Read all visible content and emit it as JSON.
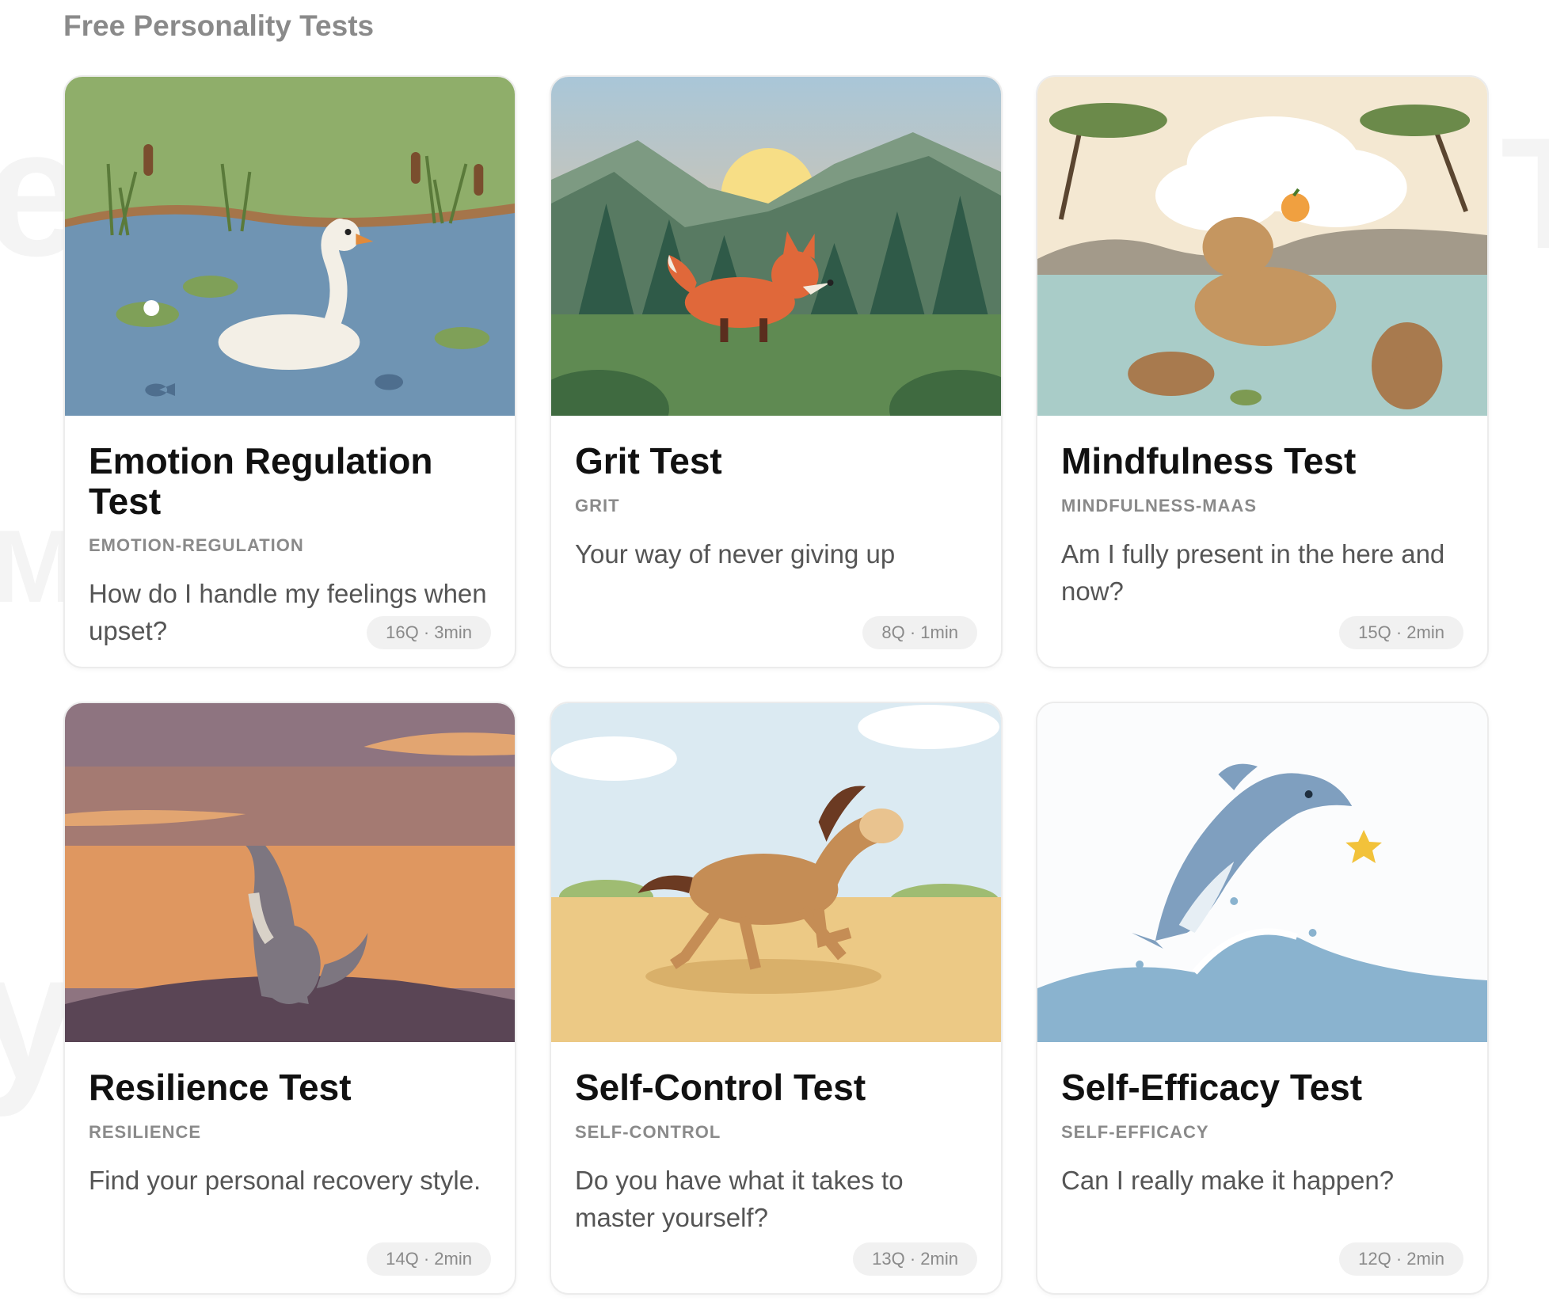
{
  "section": {
    "title": "Free Personality Tests"
  },
  "colors": {
    "card_border": "#ececec",
    "title": "#111111",
    "muted": "#8a8a8a",
    "desc": "#555555",
    "pill_bg": "#f1f1f1"
  },
  "cards": [
    {
      "title": "Emotion Regulation Test",
      "slug": "EMOTION-REGULATION",
      "description": "How do I handle my feelings when upset?",
      "meta": "16Q · 3min",
      "illustration": "swan-pond"
    },
    {
      "title": "Grit Test",
      "slug": "GRIT",
      "description": "Your way of never giving up",
      "meta": "8Q · 1min",
      "illustration": "fox-forest-sunrise"
    },
    {
      "title": "Mindfulness Test",
      "slug": "MINDFULNESS-MAAS",
      "description": "Am I fully present in the here and now?",
      "meta": "15Q · 2min",
      "illustration": "capybara-river"
    },
    {
      "title": "Resilience Test",
      "slug": "RESILIENCE",
      "description": "Find your personal recovery style.",
      "meta": "14Q · 2min",
      "illustration": "howling-wolf-dusk"
    },
    {
      "title": "Self-Control Test",
      "slug": "SELF-CONTROL",
      "description": "Do you have what it takes to master yourself?",
      "meta": "13Q · 2min",
      "illustration": "galloping-horse-field"
    },
    {
      "title": "Self-Efficacy Test",
      "slug": "SELF-EFFICACY",
      "description": "Can I really make it happen?",
      "meta": "12Q · 2min",
      "illustration": "dolphin-wave-star"
    }
  ]
}
